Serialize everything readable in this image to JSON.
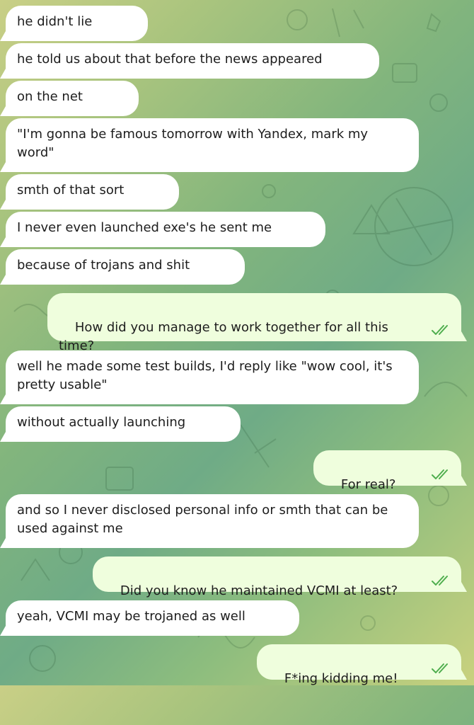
{
  "messages": [
    {
      "direction": "in",
      "text": "he didn't lie"
    },
    {
      "direction": "in",
      "text": "he told us about that before the news appeared"
    },
    {
      "direction": "in",
      "text": "on the net"
    },
    {
      "direction": "in",
      "text": "\"I'm gonna be famous tomorrow with Yandex, mark my\nword\""
    },
    {
      "direction": "in",
      "text": "smth of that sort"
    },
    {
      "direction": "in",
      "text": "I never even launched exe's he sent me"
    },
    {
      "direction": "in",
      "text": "because of trojans and shit"
    },
    {
      "direction": "out",
      "text": "How did you manage to work together for all this time?",
      "status": "read"
    },
    {
      "direction": "in",
      "text": "well he made some test builds, I'd reply like \"wow cool, it's\npretty usable\""
    },
    {
      "direction": "in",
      "text": "without actually launching"
    },
    {
      "direction": "out",
      "text": "For real?",
      "status": "read"
    },
    {
      "direction": "in",
      "text": "and so I never disclosed personal info or smth that can be\nused against me"
    },
    {
      "direction": "out",
      "text": "Did you know he maintained VCMI at least?",
      "status": "read"
    },
    {
      "direction": "in",
      "text": "yeah, VCMI may be trojaned as well"
    },
    {
      "direction": "out",
      "text": "F*ing kidding me!",
      "status": "read"
    }
  ],
  "colors": {
    "incoming_bubble": "#ffffff",
    "outgoing_bubble": "#effedd",
    "read_check": "#4fae4e"
  },
  "icons": {
    "read_status": "double-check-icon"
  }
}
